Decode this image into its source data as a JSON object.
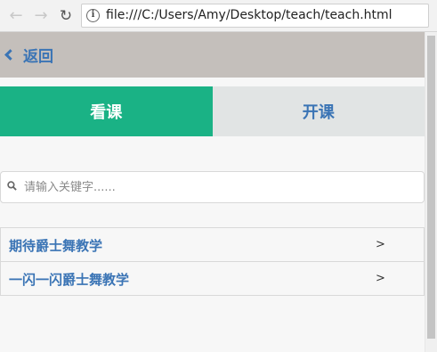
{
  "browser": {
    "url": "file:///C:/Users/Amy/Desktop/teach/teach.html",
    "info_glyph": "i"
  },
  "header": {
    "back_label": "返回"
  },
  "tabs": [
    {
      "label": "看课",
      "active": true
    },
    {
      "label": "开课",
      "active": false
    }
  ],
  "search": {
    "placeholder": "请输入关键字......",
    "value": ""
  },
  "courses": [
    {
      "title": "期待爵士舞教学",
      "arrow": ">"
    },
    {
      "title": "一闪一闪爵士舞教学",
      "arrow": ">"
    }
  ],
  "colors": {
    "header_bg": "#c4bfbb",
    "accent_green": "#1ab285",
    "link_blue": "#3a74b5",
    "inactive_tab_bg": "#e1e4e4"
  }
}
